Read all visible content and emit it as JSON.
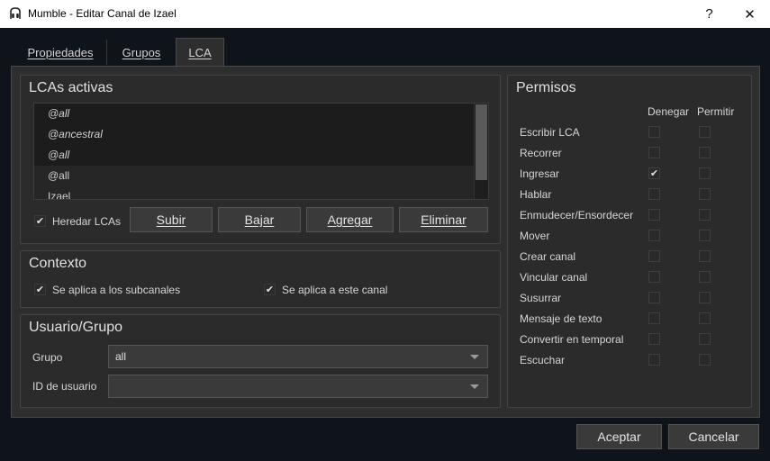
{
  "window": {
    "title": "Mumble - Editar Canal de Izael",
    "help_glyph": "?",
    "close_glyph": "✕"
  },
  "tabs": [
    {
      "label": "Propiedades"
    },
    {
      "label": "Grupos"
    },
    {
      "label": "LCA"
    }
  ],
  "acl": {
    "title": "LCAs activas",
    "entries": [
      {
        "label": "@all"
      },
      {
        "label": "@ancestral"
      },
      {
        "label": "@all"
      },
      {
        "label": "@all"
      },
      {
        "label": "Izael"
      }
    ],
    "inherit_label": "Heredar LCAs",
    "inherit_checked": true,
    "buttons": {
      "up": "Subir",
      "down": "Bajar",
      "add": "Agregar",
      "remove": "Eliminar"
    }
  },
  "context": {
    "title": "Contexto",
    "subchannels_label": "Se aplica a los subcanales",
    "this_channel_label": "Se aplica a este canal",
    "subchannels_checked": true,
    "this_channel_checked": true
  },
  "user_group": {
    "title": "Usuario/Grupo",
    "group_label": "Grupo",
    "group_value": "all",
    "user_id_label": "ID de usuario",
    "user_id_value": ""
  },
  "permissions": {
    "title": "Permisos",
    "deny_header": "Denegar",
    "allow_header": "Permitir",
    "rows": [
      {
        "label": "Escribir LCA",
        "deny": false,
        "allow": false
      },
      {
        "label": "Recorrer",
        "deny": false,
        "allow": false
      },
      {
        "label": "Ingresar",
        "deny": true,
        "allow": false
      },
      {
        "label": "Hablar",
        "deny": false,
        "allow": false
      },
      {
        "label": "Enmudecer/Ensordecer",
        "deny": false,
        "allow": false
      },
      {
        "label": "Mover",
        "deny": false,
        "allow": false
      },
      {
        "label": "Crear canal",
        "deny": false,
        "allow": false
      },
      {
        "label": "Vincular canal",
        "deny": false,
        "allow": false
      },
      {
        "label": "Susurrar",
        "deny": false,
        "allow": false
      },
      {
        "label": "Mensaje de texto",
        "deny": false,
        "allow": false
      },
      {
        "label": "Convertir en temporal",
        "deny": false,
        "allow": false
      },
      {
        "label": "Escuchar",
        "deny": false,
        "allow": false
      }
    ]
  },
  "footer": {
    "accept": "Aceptar",
    "cancel": "Cancelar"
  },
  "check_glyph": "✔"
}
